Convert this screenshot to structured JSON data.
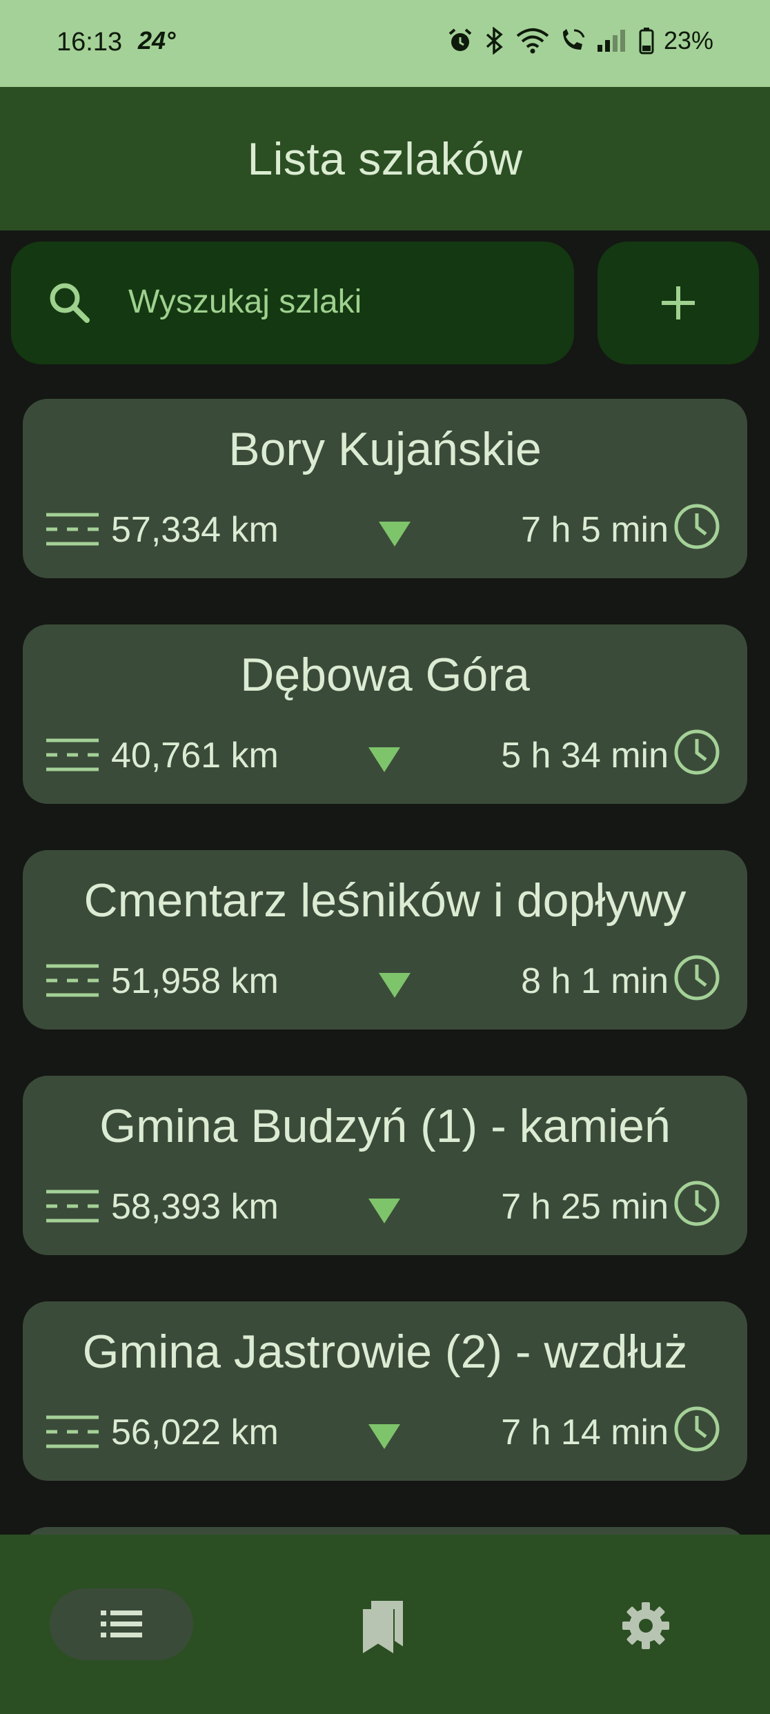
{
  "status_bar": {
    "time": "16:13",
    "temperature": "24°",
    "battery": "23%",
    "icons": [
      "alarm-icon",
      "bluetooth-icon",
      "wifi-icon",
      "wifi-calling-icon",
      "signal-icon",
      "battery-icon"
    ]
  },
  "app_bar": {
    "title": "Lista szlaków"
  },
  "search": {
    "placeholder": "Wyszukaj szlaki",
    "icon": "search-icon"
  },
  "add_button": {
    "icon": "plus-icon"
  },
  "trails": [
    {
      "name": "Bory Kujańskie",
      "distance": "57,334 km",
      "duration": "7 h 5 min"
    },
    {
      "name": "Dębowa Góra",
      "distance": "40,761 km",
      "duration": "5 h 34 min"
    },
    {
      "name": "Cmentarz leśników i dopływy",
      "distance": "51,958 km",
      "duration": "8 h 1 min"
    },
    {
      "name": "Gmina Budzyń (1) - kamień",
      "distance": "58,393 km",
      "duration": "7 h 25 min"
    },
    {
      "name": "Gmina Jastrowie (2) - wzdłuż",
      "distance": "56,022 km",
      "duration": "7 h 14 min"
    }
  ],
  "bottom_nav": {
    "items": [
      {
        "icon": "list-icon",
        "selected": true
      },
      {
        "icon": "bookmarks-icon",
        "selected": false
      },
      {
        "icon": "settings-icon",
        "selected": false
      }
    ]
  },
  "colors": {
    "status_bar": "#a4d197",
    "app_bar": "#2b4f23",
    "background": "#151714",
    "card": "#3b4b39",
    "accent": "#9fd18f",
    "search_bg": "#143811"
  }
}
